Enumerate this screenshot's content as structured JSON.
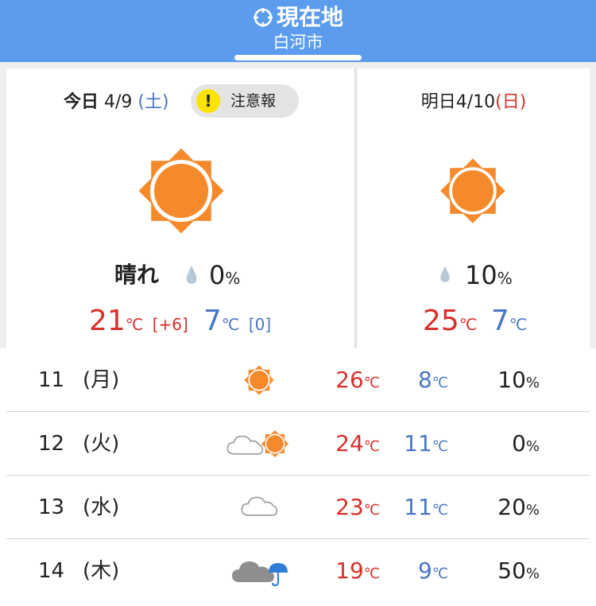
{
  "header": {
    "title": "現在地",
    "subtitle": "白河市",
    "icon": "location-target-icon",
    "color": "#5b9cee"
  },
  "today": {
    "label": "今日",
    "date": "4/9",
    "weekday": "(土)",
    "warning": {
      "icon": "exclamation-icon",
      "label": "注意報",
      "color": "#fde400"
    },
    "weather_icon": "sun-icon",
    "weather": "晴れ",
    "pop": "0",
    "pop_unit": "%",
    "high": "21",
    "high_diff": "[+6]",
    "low": "7",
    "low_diff": "[0]",
    "temp_unit": "℃"
  },
  "tomorrow": {
    "label": "明日",
    "date": "4/10",
    "weekday": "(日)",
    "weather_icon": "sun-icon",
    "pop": "10",
    "pop_unit": "%",
    "high": "25",
    "low": "7",
    "temp_unit": "℃"
  },
  "forecast": [
    {
      "date": "11",
      "weekday": "(月)",
      "icon": "sun-icon",
      "high": "26",
      "low": "8",
      "pop": "10"
    },
    {
      "date": "12",
      "weekday": "(火)",
      "icon": "cloud-then-sun-icon",
      "high": "24",
      "low": "11",
      "pop": "0"
    },
    {
      "date": "13",
      "weekday": "(水)",
      "icon": "cloud-icon",
      "high": "23",
      "low": "11",
      "pop": "20"
    },
    {
      "date": "14",
      "weekday": "(木)",
      "icon": "cloud-with-umbrella-icon",
      "high": "19",
      "low": "9",
      "pop": "50"
    }
  ],
  "units": {
    "temp": "℃",
    "percent": "%"
  },
  "colors": {
    "high": "#d9302c",
    "low": "#4a76c4",
    "sun": "#f58a2c"
  }
}
